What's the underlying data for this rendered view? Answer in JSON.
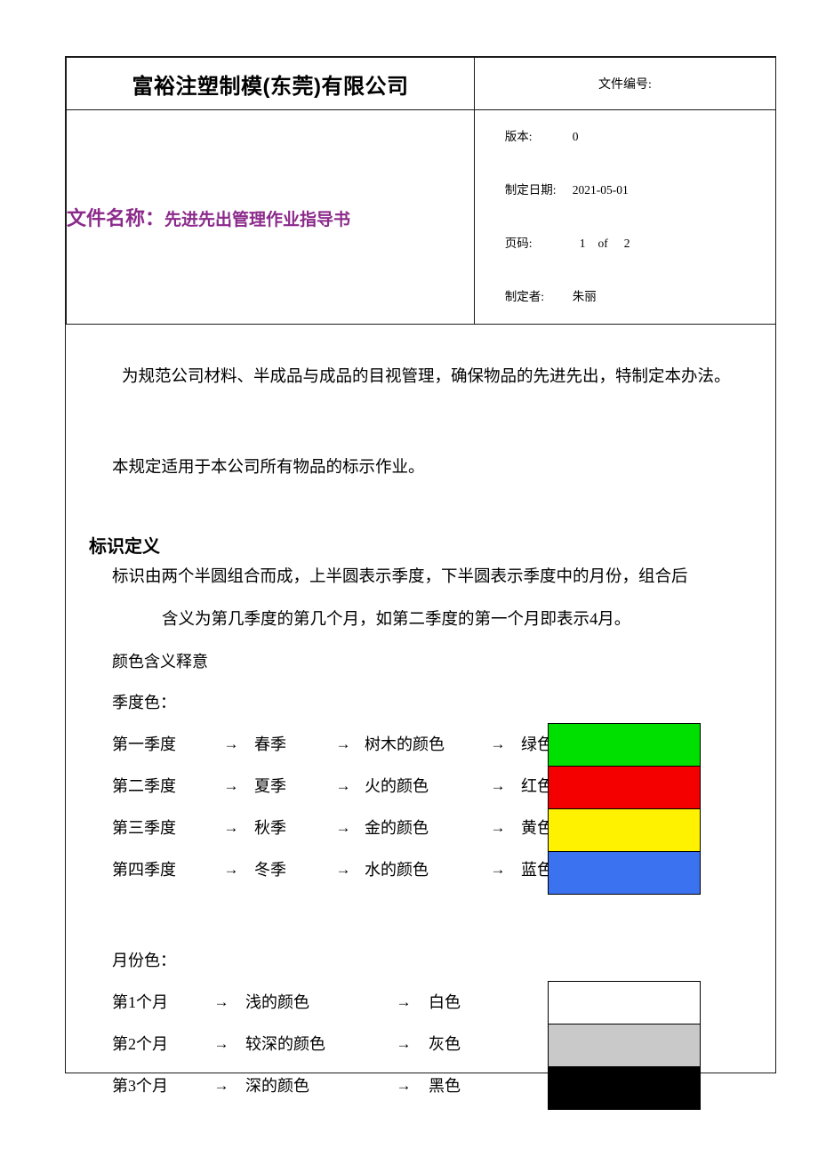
{
  "header": {
    "company_name": "富裕注塑制模(东莞)有限公司",
    "doc_no_label": "文件编号:",
    "doc_name_label": "文件名称：",
    "doc_name_value": "先进先出管理作业指导书",
    "meta": {
      "version_label": "版本:",
      "version_value": "0",
      "date_label": "制定日期:",
      "date_value": "2021-05-01",
      "page_label": "页码:",
      "page_value": "1",
      "page_of": "of",
      "page_total": "2",
      "author_label": "制定者:",
      "author_value": "朱丽"
    }
  },
  "body": {
    "purpose_paragraph": "为规范公司材料、半成品与成品的目视管理，确保物品的先进先出，特制定本办法。",
    "scope_paragraph": "本规定适用于本公司所有物品的标示作业。",
    "section_title": "标识定义",
    "definition_line1": "标识由两个半圆组合而成，上半圆表示季度，下半圆表示季度中的月份，组合后",
    "definition_line2": "含义为第几季度的第几个月，如第二季度的第一个月即表示4月。",
    "color_meaning_heading": "颜色含义释意",
    "quarter_heading": "季度色：",
    "month_heading": "月份色："
  },
  "quarter_rows": [
    {
      "quarter": "第一季度",
      "arrow1": "→",
      "season": "春季",
      "arrow2": "→",
      "symbol": "树木的颜色",
      "arrow3": "→",
      "color_name": "绿色",
      "arrow4": "→",
      "swatch_hex": "#00E000"
    },
    {
      "quarter": "第二季度",
      "arrow1": "→",
      "season": "夏季",
      "arrow2": "→",
      "symbol": "火的颜色",
      "arrow3": "→",
      "color_name": "红色",
      "arrow4": "→",
      "swatch_hex": "#F50000"
    },
    {
      "quarter": "第三季度",
      "arrow1": "→",
      "season": "秋季",
      "arrow2": "→",
      "symbol": "金的颜色",
      "arrow3": "→",
      "color_name": "黄色",
      "arrow4": "→",
      "swatch_hex": "#FFF200"
    },
    {
      "quarter": "第四季度",
      "arrow1": "→",
      "season": "冬季",
      "arrow2": "→",
      "symbol": "水的颜色",
      "arrow3": "→",
      "color_name": "蓝色",
      "arrow4": "→",
      "swatch_hex": "#3A72F0"
    }
  ],
  "month_rows": [
    {
      "month": "第1个月",
      "arrow1": "→",
      "shade": "浅的颜色",
      "arrow2": "→",
      "color_name": "白色",
      "arrow3": "→",
      "swatch_hex": "#FFFFFF"
    },
    {
      "month": "第2个月",
      "arrow1": "→",
      "shade": "较深的颜色",
      "arrow2": "→",
      "color_name": "灰色",
      "arrow3": "→",
      "swatch_hex": "#C9C9C9"
    },
    {
      "month": "第3个月",
      "arrow1": "→",
      "shade": "深的颜色",
      "arrow2": "→",
      "color_name": "黑色",
      "arrow3": "→",
      "swatch_hex": "#000000"
    }
  ],
  "theme": {
    "doc_name_color": "#8B2A8B",
    "border_color": "#1A1A1A",
    "page_background": "#FFFFFF"
  }
}
